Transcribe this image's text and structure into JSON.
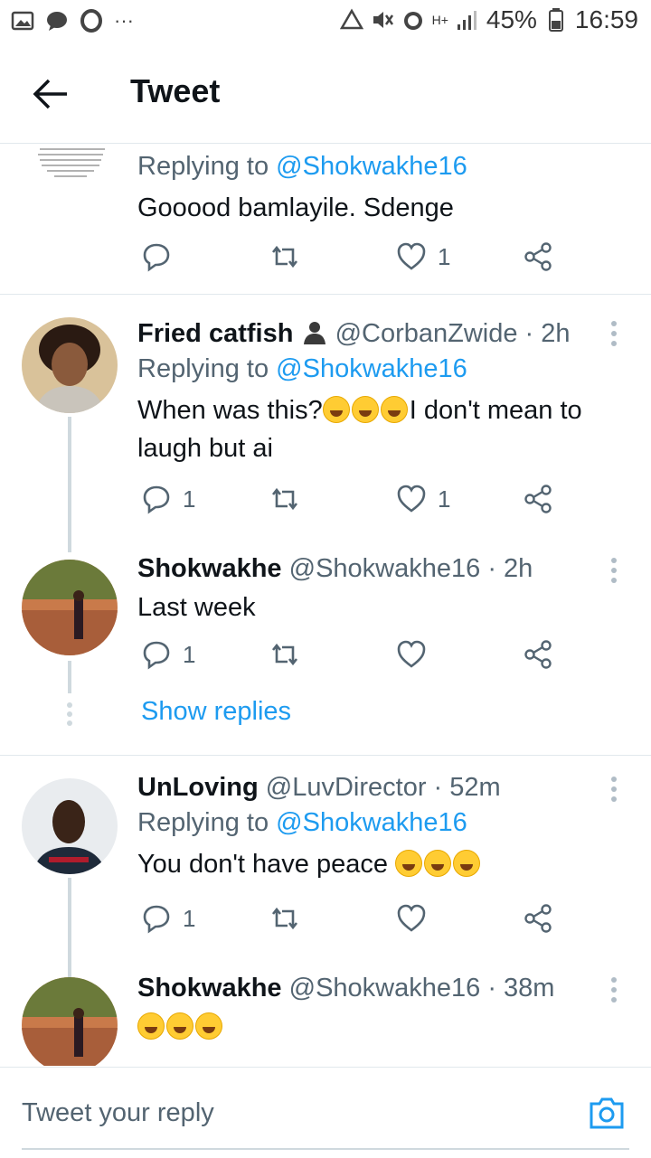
{
  "status_bar": {
    "battery": "45%",
    "time": "16:59",
    "network": "H+",
    "dots": "···"
  },
  "header": {
    "title": "Tweet"
  },
  "tweets": [
    {
      "replying_prefix": "Replying to ",
      "replying_handle": "@Shokwakhe16",
      "text": "Gooood bamlayile. Sdenge",
      "actions": {
        "replies": "",
        "retweets": "",
        "likes": "1"
      }
    },
    {
      "name": "Fried catfish",
      "handle": "@CorbanZwide",
      "time": "· 2h",
      "replying_prefix": "Replying to ",
      "replying_handle": "@Shokwakhe16",
      "text_a": "When was this?",
      "text_b": "I don't mean to laugh but ai",
      "actions": {
        "replies": "1",
        "retweets": "",
        "likes": "1"
      }
    },
    {
      "name": "Shokwakhe",
      "handle": "@Shokwakhe16",
      "time": "· 2h",
      "text": "Last week",
      "actions": {
        "replies": "1",
        "retweets": "",
        "likes": ""
      }
    },
    {
      "name": "UnLoving",
      "handle": "@LuvDirector",
      "time": "· 52m",
      "replying_prefix": "Replying to ",
      "replying_handle": "@Shokwakhe16",
      "text": "You don't have  peace ",
      "actions": {
        "replies": "1",
        "retweets": "",
        "likes": ""
      }
    },
    {
      "name": "Shokwakhe",
      "handle": "@Shokwakhe16",
      "time": "· 38m"
    }
  ],
  "show_replies": "Show replies",
  "composer": {
    "placeholder": "Tweet your reply"
  },
  "colors": {
    "accent": "#1d9bf0",
    "muted": "#536471"
  }
}
